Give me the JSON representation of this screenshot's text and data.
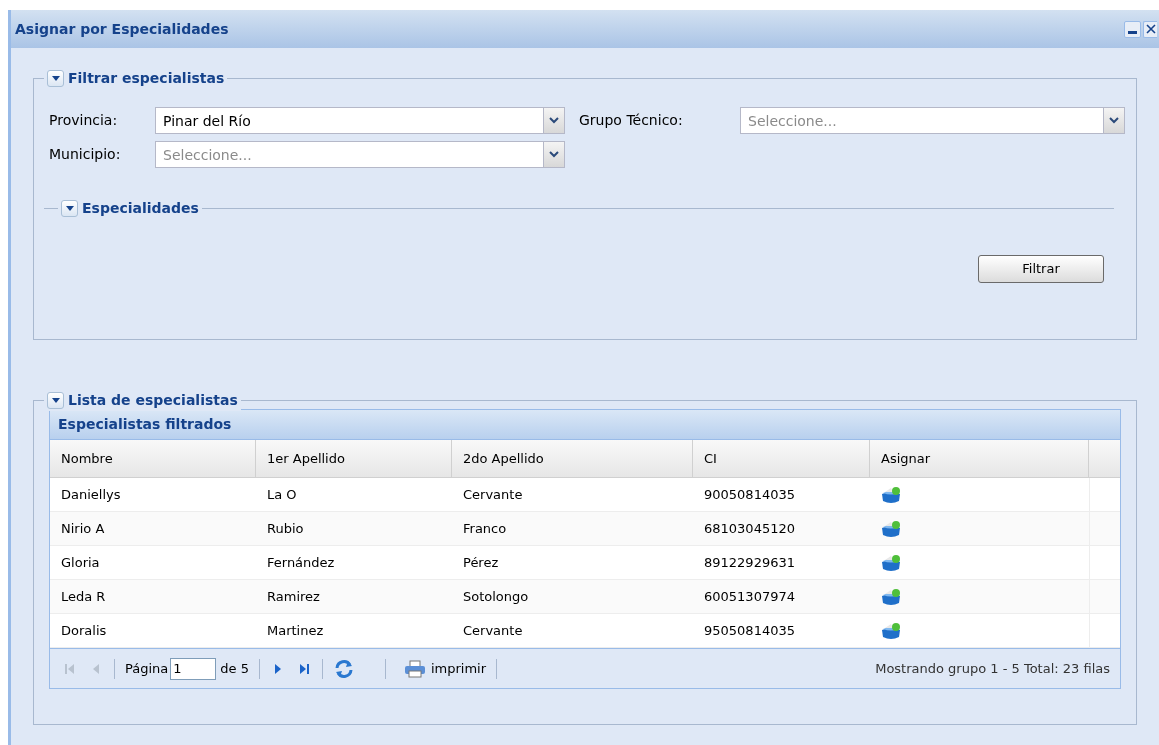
{
  "window": {
    "title": "Asignar por Especialidades"
  },
  "filter": {
    "legend": "Filtrar especialistas",
    "expanded": true,
    "fields": [
      {
        "label": "Provincia:",
        "value": "Pinar del Río"
      },
      {
        "label": "Grupo Técnico:",
        "placeholder": "Seleccione..."
      },
      {
        "label": "Municipio:",
        "placeholder": "Seleccione..."
      }
    ],
    "sub_legend": "Especialidades",
    "button": "Filtrar"
  },
  "list": {
    "legend": "Lista de especialistas",
    "expanded": true,
    "grid_title": "Especialistas filtrados",
    "columns": [
      "Nombre",
      "1er Apellido",
      "2do Apellido",
      "CI",
      "Asignar"
    ],
    "rows": [
      {
        "cells": [
          "Daniellys",
          "La O",
          "Cervante",
          "90050814035"
        ]
      },
      {
        "cells": [
          "Nirio A",
          "Rubio",
          "Franco",
          "68103045120"
        ]
      },
      {
        "cells": [
          "Gloria",
          "Fernández",
          "Pérez",
          "89122929631"
        ]
      },
      {
        "cells": [
          "Leda R",
          "Ramirez",
          "Sotolongo",
          "60051307974"
        ]
      },
      {
        "cells": [
          "Doralis",
          "Martinez",
          "Cervante",
          "95050814035"
        ]
      }
    ],
    "paging": {
      "first_disabled": true,
      "prev_disabled": true,
      "page_label": "Página",
      "page": "1",
      "of": "de 5",
      "print": "imprimir",
      "summary": "Mostrando grupo 1 - 5 Total: 23 filas"
    }
  }
}
